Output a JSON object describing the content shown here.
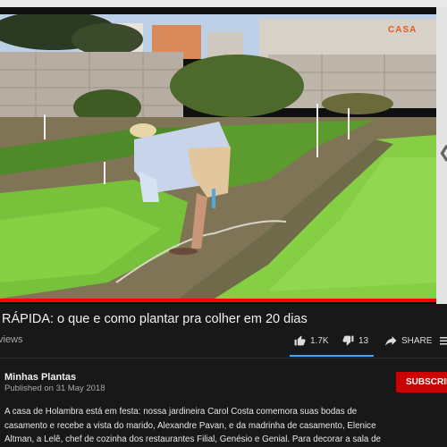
{
  "video": {
    "watermark": "CASA",
    "progress": 1.0
  },
  "title": "RÁPIDA: o que e como plantar pra colher em 20 dias",
  "views_label": "views",
  "actions": {
    "likes": "1.7K",
    "dislikes": "13",
    "share_label": "SHARE"
  },
  "channel": {
    "name": "Minhas Plantas",
    "published": "Published on 31 May 2018",
    "subscribe_label": "SUBSCRIBE"
  },
  "description": {
    "lines": [
      "A casa de Holambra está em festa: nossa jardineira Carol Costa comemora suas bodas de",
      "casamento e recebe a vista do marido, Alexandre Pavan, e da madrinha de casamento, Elenice",
      "Altman, a Lelê, chef de cozinha dos restaurantes Filial, Genésio e Genial. Para decorar a sala de"
    ]
  },
  "colors": {
    "accent_blue": "#3ea6ff",
    "subscribe_red": "#cc0000",
    "progress_red": "#ff0000"
  }
}
